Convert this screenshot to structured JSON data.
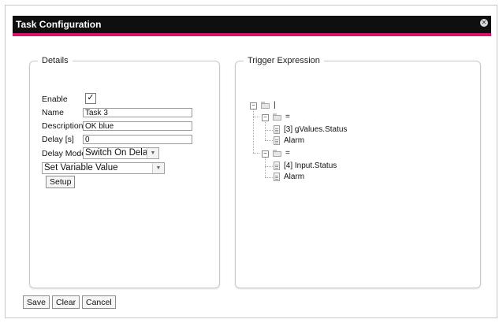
{
  "dialog": {
    "title": "Task Configuration",
    "close_glyph": "✕"
  },
  "details": {
    "legend": "Details",
    "enable": {
      "label": "Enable",
      "checked_glyph": "✓"
    },
    "name": {
      "label": "Name",
      "value": "Task 3"
    },
    "description": {
      "label": "Description",
      "value": "OK blue"
    },
    "delay": {
      "label": "Delay [s]",
      "value": "0"
    },
    "delay_mode": {
      "label": "Delay Mode",
      "value": "Switch On Delay"
    },
    "action": {
      "value": "Set Variable Value"
    },
    "setup_label": "Setup"
  },
  "trigger": {
    "legend": "Trigger Expression",
    "root": {
      "label": "|",
      "expander": "−"
    },
    "groups": [
      {
        "label": "=",
        "expander": "−",
        "children": [
          "[3] gValues.Status",
          "Alarm"
        ]
      },
      {
        "label": "=",
        "expander": "−",
        "children": [
          "[4] Input.Status",
          "Alarm"
        ]
      }
    ]
  },
  "footer": {
    "save_label": "Save",
    "clear_label": "Clear",
    "cancel_label": "Cancel"
  },
  "colors": {
    "titlebar": "#0f0f0f",
    "accent": "#d6146b"
  },
  "icons": {
    "close": "close-icon",
    "checkbox": "check-icon",
    "dropdown": "chevron-down-icon",
    "folder": "folder-icon",
    "item": "document-icon"
  }
}
